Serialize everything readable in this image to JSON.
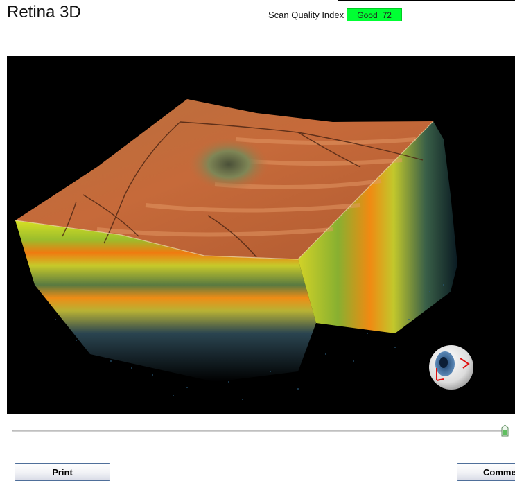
{
  "window": {
    "title": "Retina 3D"
  },
  "scan_quality": {
    "label": "Scan Quality Index",
    "status": "Good",
    "value": "72",
    "color": "#00ff33"
  },
  "viewer": {
    "background": "#000000",
    "orientation_icon": "eye-orientation-icon"
  },
  "slider": {
    "position_fraction": 1.0
  },
  "buttons": {
    "print_label": "Print",
    "comment_label": "Comme"
  }
}
